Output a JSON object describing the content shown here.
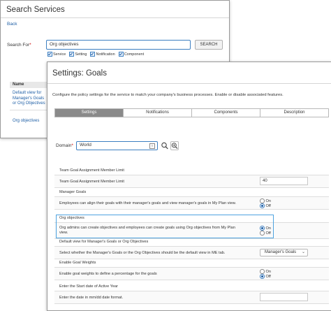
{
  "search_window": {
    "title": "Search Services",
    "back_label": "Back",
    "search_for_label": "Search For",
    "required_mark": "*",
    "search_value": "Org objectives",
    "search_button": "SEARCH",
    "filters": [
      "Service",
      "Setting",
      "Notification",
      "Component"
    ],
    "results_header": "Name",
    "results": [
      "Default view for Manager's Goals or Org Objectives",
      "Org objectives"
    ]
  },
  "settings_window": {
    "title": "Settings: Goals",
    "description": "Configure the policy settings for the service to match your company's business processes. Enable or disable associated features.",
    "tabs": [
      {
        "label": "Settings",
        "active": true
      },
      {
        "label": "Notifications",
        "active": false
      },
      {
        "label": "Components",
        "active": false
      },
      {
        "label": "Description",
        "active": false
      }
    ],
    "domain_label": "Domain",
    "required_mark": "*",
    "domain_value": "World",
    "sections": [
      {
        "heading": "Team Goal Assignment Member Limit",
        "row": "Team Goal Assignment Member Limit",
        "value": "40"
      },
      {
        "heading": "Manager Goals",
        "row": "Employees can align their goals with their manager's goals and view manager's goals in My Plan view.",
        "options": [
          "On",
          "Off"
        ],
        "selected": "Off"
      },
      {
        "heading": "Org objectives",
        "row": "Org admins can create objectives and employees can create goals using Org objectives from My Plan view.",
        "options": [
          "On",
          "Off"
        ],
        "selected": "On"
      },
      {
        "heading": "Default view for Manager's Goals or Org Objectives",
        "row": "Select whether the Manager's Goals or the Org Objectives should be the default view in ME tab.",
        "value": "Manager's Goals"
      },
      {
        "heading": "Enable Goal Weights",
        "row": "Enable goal weights to define a percentage for the goals",
        "options": [
          "On",
          "Off"
        ],
        "selected": "Off"
      },
      {
        "heading": "Enter the Start date of Active Year",
        "row": "Enter the date in mm/dd date format.",
        "value": ""
      }
    ]
  }
}
